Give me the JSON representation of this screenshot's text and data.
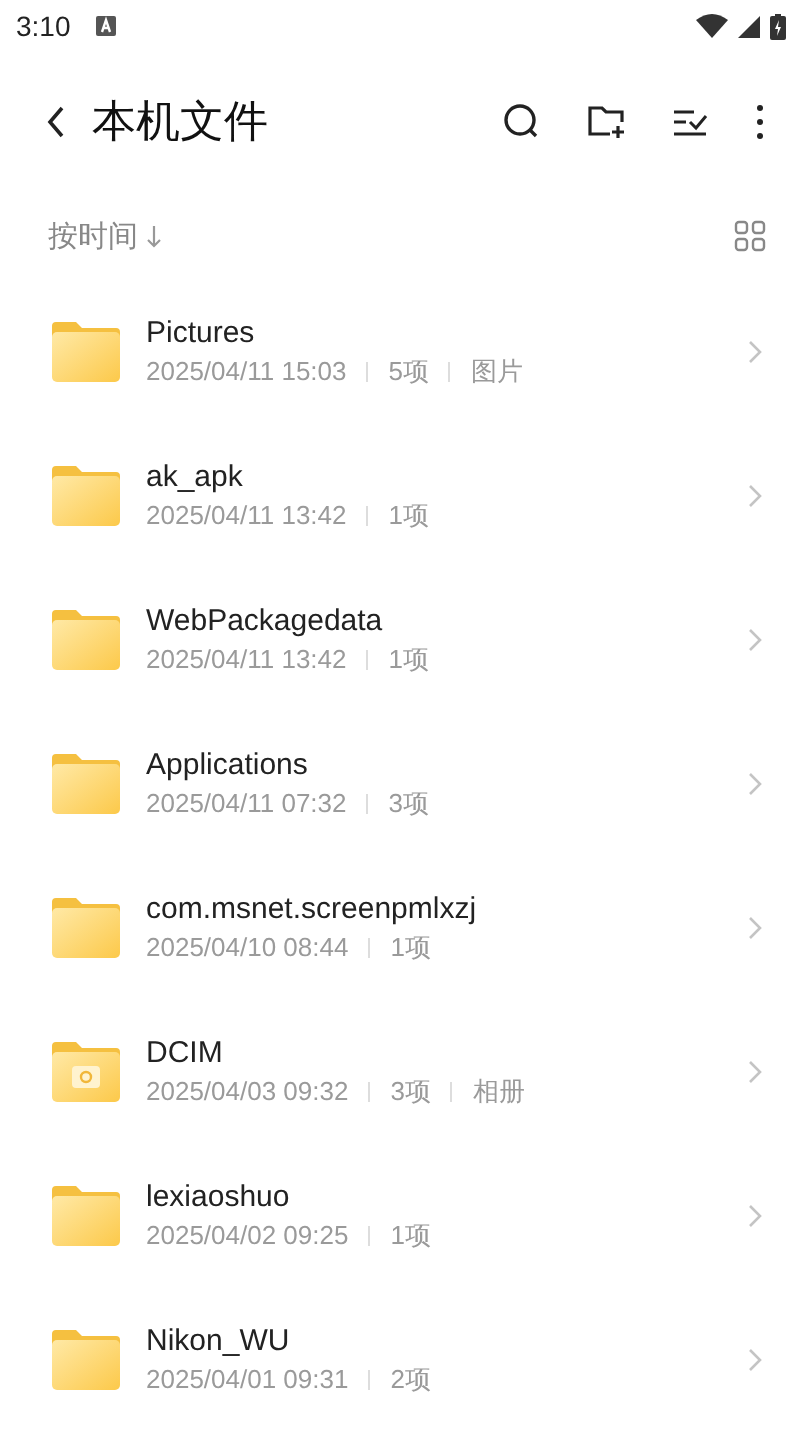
{
  "status_bar": {
    "time": "3:10"
  },
  "header": {
    "title": "本机文件"
  },
  "sort": {
    "label": "按时间"
  },
  "folders": [
    {
      "name": "Pictures",
      "kind": "plain",
      "meta": [
        "2025/04/11 15:03",
        "5项",
        "图片"
      ]
    },
    {
      "name": "ak_apk",
      "kind": "plain",
      "meta": [
        "2025/04/11 13:42",
        "1项"
      ]
    },
    {
      "name": "WebPackagedata",
      "kind": "plain",
      "meta": [
        "2025/04/11 13:42",
        "1项"
      ]
    },
    {
      "name": "Applications",
      "kind": "plain",
      "meta": [
        "2025/04/11 07:32",
        "3项"
      ]
    },
    {
      "name": "com.msnet.screenpmlxzj",
      "kind": "plain",
      "meta": [
        "2025/04/10 08:44",
        "1项"
      ]
    },
    {
      "name": "DCIM",
      "kind": "camera",
      "meta": [
        "2025/04/03 09:32",
        "3项",
        "相册"
      ]
    },
    {
      "name": "lexiaoshuo",
      "kind": "plain",
      "meta": [
        "2025/04/02 09:25",
        "1项"
      ]
    },
    {
      "name": "Nikon_WU",
      "kind": "plain",
      "meta": [
        "2025/04/01 09:31",
        "2项"
      ]
    }
  ]
}
